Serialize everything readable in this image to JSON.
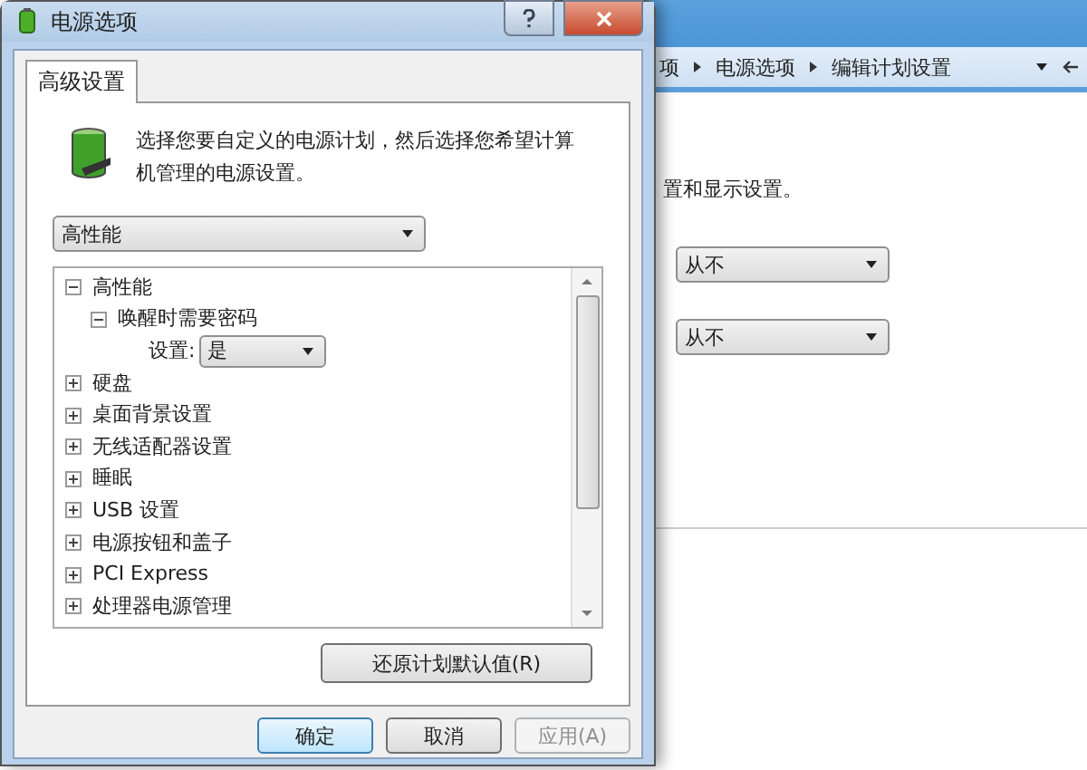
{
  "background_window": {
    "breadcrumb": [
      "项",
      "电源选项",
      "编辑计划设置"
    ],
    "description": "置和显示设置。",
    "dropdowns": [
      {
        "value": "从不"
      },
      {
        "value": "从不"
      }
    ]
  },
  "dialog": {
    "title": "电源选项",
    "tabs": [
      {
        "label": "高级设置",
        "selected": true
      }
    ],
    "intro": "选择您要自定义的电源计划，然后选择您希望计算机管理的电源设置。",
    "plan_select": {
      "value": "高性能"
    },
    "tree": [
      {
        "kind": "group",
        "label": "高性能",
        "expanded": true,
        "children": [
          {
            "kind": "group",
            "label": "唤醒时需要密码",
            "expanded": true,
            "children": [
              {
                "kind": "setting",
                "label": "设置:",
                "value": "是"
              }
            ]
          }
        ]
      },
      {
        "kind": "group",
        "label": "硬盘",
        "expanded": false
      },
      {
        "kind": "group",
        "label": "桌面背景设置",
        "expanded": false
      },
      {
        "kind": "group",
        "label": "无线适配器设置",
        "expanded": false
      },
      {
        "kind": "group",
        "label": "睡眠",
        "expanded": false
      },
      {
        "kind": "group",
        "label": "USB 设置",
        "expanded": false
      },
      {
        "kind": "group",
        "label": "电源按钮和盖子",
        "expanded": false
      },
      {
        "kind": "group",
        "label": "PCI Express",
        "expanded": false
      },
      {
        "kind": "group",
        "label": "处理器电源管理",
        "expanded": false
      }
    ],
    "restore_button": "还原计划默认值(R)",
    "buttons": [
      {
        "label": "确定",
        "disabled": false,
        "default": true
      },
      {
        "label": "取消",
        "disabled": false,
        "default": false
      },
      {
        "label": "应用(A)",
        "disabled": true,
        "default": false
      }
    ]
  }
}
